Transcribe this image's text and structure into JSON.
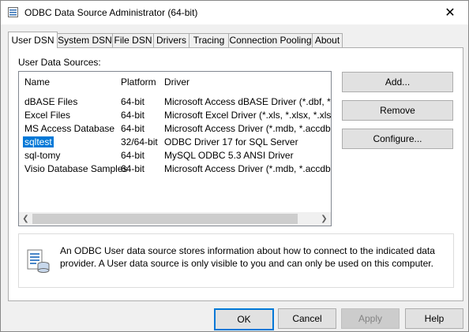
{
  "window": {
    "title": "ODBC Data Source Administrator (64-bit)",
    "close": "✕"
  },
  "tabs": [
    {
      "label": "User DSN"
    },
    {
      "label": "System DSN"
    },
    {
      "label": "File DSN"
    },
    {
      "label": "Drivers"
    },
    {
      "label": "Tracing"
    },
    {
      "label": "Connection Pooling"
    },
    {
      "label": "About"
    }
  ],
  "main": {
    "group_label": "User Data Sources:",
    "columns": {
      "name": "Name",
      "platform": "Platform",
      "driver": "Driver"
    },
    "rows": [
      {
        "name": "dBASE Files",
        "platform": "64-bit",
        "driver": "Microsoft Access dBASE Driver (*.dbf, *.ndx,"
      },
      {
        "name": "Excel Files",
        "platform": "64-bit",
        "driver": "Microsoft Excel Driver (*.xls, *.xlsx, *.xlsm, *.xl"
      },
      {
        "name": "MS Access Database",
        "platform": "64-bit",
        "driver": "Microsoft Access Driver (*.mdb, *.accdb)"
      },
      {
        "name": "sqltest",
        "platform": "32/64-bit",
        "driver": "ODBC Driver 17 for SQL Server"
      },
      {
        "name": "sql-tomy",
        "platform": "64-bit",
        "driver": "MySQL ODBC 5.3 ANSI Driver"
      },
      {
        "name": "Visio Database Samples",
        "platform": "64-bit",
        "driver": "Microsoft Access Driver (*.mdb, *.accdb)"
      }
    ],
    "selected_row_index": 3,
    "buttons": {
      "add": "Add...",
      "remove": "Remove",
      "configure": "Configure..."
    },
    "info_text": "An ODBC User data source stores information about how to connect to the indicated data provider.   A User data source is only visible to you and can only be used on this computer."
  },
  "footer": {
    "ok": "OK",
    "cancel": "Cancel",
    "apply": "Apply",
    "help": "Help"
  },
  "colors": {
    "selection": "#0078d7",
    "default_button_border": "#0078d7"
  },
  "icons": {
    "app": "odbc-app-icon",
    "info": "data-source-info-icon",
    "close": "close-icon"
  }
}
